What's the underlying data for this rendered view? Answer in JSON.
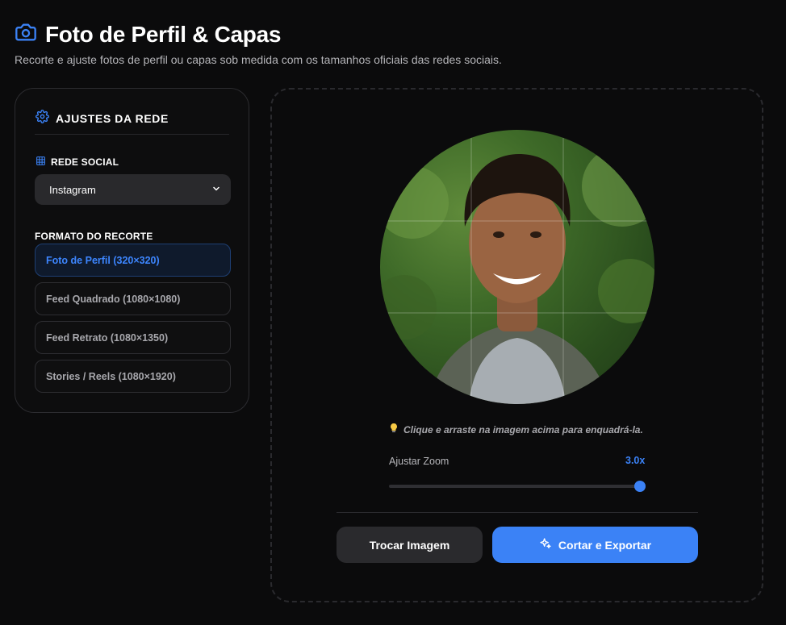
{
  "header": {
    "title": "Foto de Perfil & Capas",
    "subtitle": "Recorte e ajuste fotos de perfil ou capas sob medida com os tamanhos oficiais das redes sociais.",
    "icon": "camera-icon"
  },
  "settings": {
    "heading": "AJUSTES DA REDE",
    "heading_icon": "gear-icon",
    "network_label": "REDE SOCIAL",
    "network_icon": "grid-icon",
    "network_value": "Instagram",
    "format_label": "FORMATO DO RECORTE",
    "formats": [
      {
        "label": "Foto de Perfil (320×320)",
        "active": true
      },
      {
        "label": "Feed Quadrado (1080×1080)",
        "active": false
      },
      {
        "label": "Feed Retrato (1080×1350)",
        "active": false
      },
      {
        "label": "Stories / Reels (1080×1920)",
        "active": false
      }
    ]
  },
  "editor": {
    "hint_icon": "lightbulb-icon",
    "hint": "Clique e arraste na imagem acima para enquadrá-la.",
    "zoom_label": "Ajustar Zoom",
    "zoom_value": "3.0x",
    "zoom_fraction": 1.0,
    "swap_button": "Trocar Imagem",
    "export_button": "Cortar e Exportar",
    "export_icon": "sparkles-icon"
  },
  "colors": {
    "accent": "#3b82f6",
    "background": "#0b0b0c",
    "panel_border": "#2c2c30",
    "active_format_bg": "#0f1a2c"
  }
}
